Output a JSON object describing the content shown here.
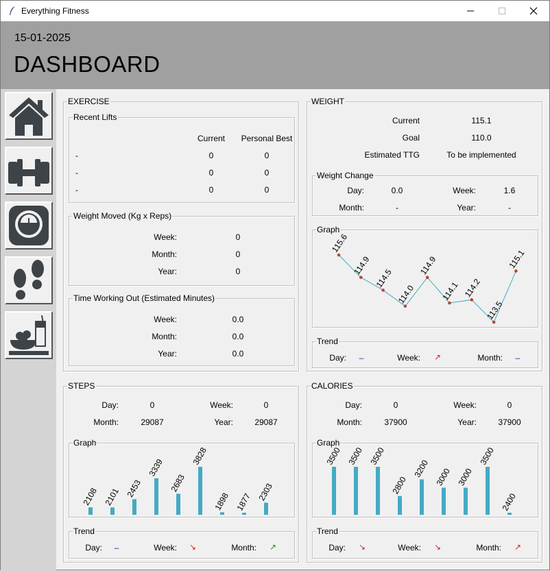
{
  "window": {
    "title": "Everything Fitness"
  },
  "header": {
    "date": "15-01-2025",
    "title": "DASHBOARD"
  },
  "nav": [
    "home-icon",
    "dumbbell-icon",
    "scale-icon",
    "footprints-icon",
    "food-icon"
  ],
  "exercise": {
    "title": "EXERCISE",
    "recent_lifts": {
      "title": "Recent Lifts",
      "col_current": "Current",
      "col_best": "Personal Best",
      "rows": [
        {
          "name": "-",
          "current": "0",
          "best": "0"
        },
        {
          "name": "-",
          "current": "0",
          "best": "0"
        },
        {
          "name": "-",
          "current": "0",
          "best": "0"
        }
      ]
    },
    "weight_moved": {
      "title": "Weight Moved (Kg x Reps)",
      "rows": [
        {
          "label": "Week:",
          "value": "0"
        },
        {
          "label": "Month:",
          "value": "0"
        },
        {
          "label": "Year:",
          "value": "0"
        }
      ]
    },
    "time_working": {
      "title": "Time Working Out (Estimated Minutes)",
      "rows": [
        {
          "label": "Week:",
          "value": "0.0"
        },
        {
          "label": "Month:",
          "value": "0.0"
        },
        {
          "label": "Year:",
          "value": "0.0"
        }
      ]
    }
  },
  "weight": {
    "title": "WEIGHT",
    "current_label": "Current",
    "current_value": "115.1",
    "goal_label": "Goal",
    "goal_value": "110.0",
    "ttg_label": "Estimated TTG",
    "ttg_value": "To be implemented",
    "change": {
      "title": "Weight Change",
      "day_label": "Day:",
      "day_value": "0.0",
      "week_label": "Week:",
      "week_value": "1.6",
      "month_label": "Month:",
      "month_value": "-",
      "year_label": "Year:",
      "year_value": "-"
    },
    "graph_title": "Graph",
    "trend": {
      "title": "Trend",
      "day_label": "Day:",
      "day_value": "–",
      "week_label": "Week:",
      "week_value": "↗",
      "month_label": "Month:",
      "month_value": "–"
    }
  },
  "steps": {
    "title": "STEPS",
    "day_label": "Day:",
    "day_value": "0",
    "week_label": "Week:",
    "week_value": "0",
    "month_label": "Month:",
    "month_value": "29087",
    "year_label": "Year:",
    "year_value": "29087",
    "graph_title": "Graph",
    "trend": {
      "title": "Trend",
      "day_label": "Day:",
      "day_value": "–",
      "week_label": "Week:",
      "week_value": "↘",
      "month_label": "Month:",
      "month_value": "↗"
    }
  },
  "calories": {
    "title": "CALORIES",
    "day_label": "Day:",
    "day_value": "0",
    "week_label": "Week:",
    "week_value": "0",
    "month_label": "Month:",
    "month_value": "37900",
    "year_label": "Year:",
    "year_value": "37900",
    "graph_title": "Graph",
    "trend": {
      "title": "Trend",
      "day_label": "Day:",
      "day_value": "↘",
      "week_label": "Week:",
      "week_value": "↘",
      "month_label": "Month:",
      "month_value": "↗"
    }
  },
  "colors": {
    "bar": "#44aac4",
    "line": "#44aac4",
    "point": "#c0442a",
    "trend_red": "#e02020",
    "trend_green": "#1a9a1a",
    "trend_blue": "#1a1aa0"
  },
  "chart_data": [
    {
      "type": "line",
      "name": "weight-graph",
      "values": [
        115.6,
        114.9,
        114.5,
        114.0,
        114.9,
        114.1,
        114.2,
        113.5,
        115.1
      ],
      "ylim": [
        113.5,
        115.6
      ]
    },
    {
      "type": "bar",
      "name": "steps-graph",
      "values": [
        2108,
        2101,
        2453,
        3339,
        2683,
        3828,
        1898,
        1877,
        2303
      ],
      "ylim": [
        1877,
        3828
      ]
    },
    {
      "type": "bar",
      "name": "calories-graph",
      "values": [
        3500,
        3500,
        3500,
        2800,
        3200,
        3000,
        3000,
        3500,
        2400
      ],
      "ylim": [
        2400,
        3500
      ]
    }
  ]
}
